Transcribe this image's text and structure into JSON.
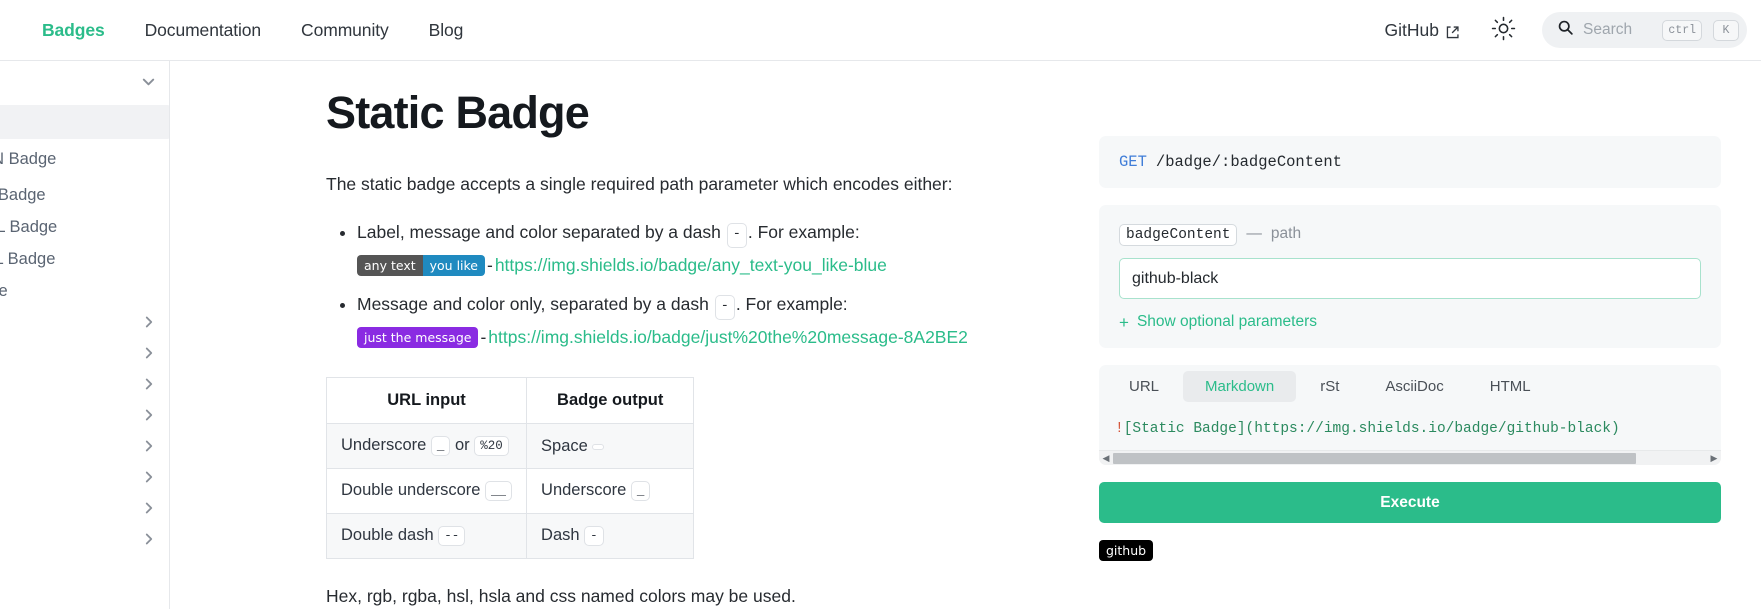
{
  "navbar": {
    "links": [
      {
        "label": "Badges",
        "active": true
      },
      {
        "label": "Documentation",
        "active": false
      },
      {
        "label": "Community",
        "active": false
      },
      {
        "label": "Blog",
        "active": false
      }
    ],
    "github_label": "GitHub",
    "github_icon": "external-link-icon",
    "theme_icon": "sun-icon",
    "search": {
      "icon": "search-icon",
      "placeholder": "Search",
      "kbd_1": "ctrl",
      "kbd_2": "K"
    }
  },
  "sidebar": {
    "group_header_label": "",
    "group_chevron_icon": "chevron-down-icon",
    "items": [
      {
        "label": "",
        "selected": true,
        "chevron": ""
      },
      {
        "label": "JSON Badge",
        "selected": false,
        "chevron": ""
      },
      {
        "label": "XML Badge",
        "selected": false,
        "chevron": ""
      },
      {
        "label": "TOML Badge",
        "selected": false,
        "chevron": ""
      },
      {
        "label": "YAML Badge",
        "selected": false,
        "chevron": ""
      },
      {
        "label": "Badge",
        "selected": false,
        "chevron": ""
      },
      {
        "label": "",
        "selected": false,
        "chevron": "chevron-right-icon"
      },
      {
        "label": "",
        "selected": false,
        "chevron": "chevron-right-icon"
      },
      {
        "label": "",
        "selected": false,
        "chevron": "chevron-right-icon"
      },
      {
        "label": "",
        "selected": false,
        "chevron": "chevron-right-icon"
      },
      {
        "label": "",
        "selected": false,
        "chevron": "chevron-right-icon"
      },
      {
        "label": "",
        "selected": false,
        "chevron": "chevron-right-icon"
      },
      {
        "label": "",
        "selected": false,
        "chevron": "chevron-right-icon"
      },
      {
        "label": "",
        "selected": false,
        "chevron": "chevron-right-icon"
      }
    ]
  },
  "main": {
    "title": "Static Badge",
    "intro": "The static badge accepts a single required path parameter which encodes either:",
    "bullets": [
      {
        "text_before": "Label, message and color separated by a dash",
        "code": "-",
        "text_after": ". For example:",
        "badge": {
          "style": "two-part",
          "left": "any text",
          "right": "you like",
          "left_color": "#555555",
          "right_color": "#1f8ac0"
        },
        "dash": "-",
        "url": "https://img.shields.io/badge/any_text-you_like-blue"
      },
      {
        "text_before": "Message and color only, separated by a dash",
        "code": "-",
        "text_after": ". For example:",
        "badge": {
          "style": "single",
          "left": "just the message",
          "left_color": "#8A2BE2"
        },
        "dash": "-",
        "url": "https://img.shields.io/badge/just%20the%20message-8A2BE2"
      }
    ],
    "table": {
      "headers": [
        "URL input",
        "Badge output"
      ],
      "rows": [
        {
          "in_text": "Underscore",
          "in_code1": "_",
          "in_mid": "or",
          "in_code2": "%20",
          "out_text": "Space",
          "out_code": " "
        },
        {
          "in_text": "Double underscore",
          "in_code1": "__",
          "in_mid": "",
          "in_code2": "",
          "out_text": "Underscore",
          "out_code": "_"
        },
        {
          "in_text": "Double dash",
          "in_code1": "--",
          "in_mid": "",
          "in_code2": "",
          "out_text": "Dash",
          "out_code": "-"
        }
      ]
    },
    "footnote": "Hex, rgb, rgba, hsl, hsla and css named colors may be used."
  },
  "api": {
    "endpoint": {
      "method": "GET",
      "path": "/badge/:badgeContent"
    },
    "parameter": {
      "name": "badgeContent",
      "kind_dash": "—",
      "kind": "path",
      "value": "github-black",
      "placeholder": ""
    },
    "show_optional": {
      "plus": "+",
      "label": "Show optional parameters"
    },
    "tabs": [
      {
        "label": "URL",
        "active": false
      },
      {
        "label": "Markdown",
        "active": true
      },
      {
        "label": "rSt",
        "active": false
      },
      {
        "label": "AsciiDoc",
        "active": false
      },
      {
        "label": "HTML",
        "active": false
      }
    ],
    "snippet": {
      "bang": "!",
      "rest": "[Static Badge](https://img.shields.io/badge/github-black)"
    },
    "scrollbar": {
      "left_arrow": "◀",
      "right_arrow": "▶"
    },
    "execute_label": "Execute",
    "result_badge": {
      "label": "github",
      "color": "#000000"
    }
  },
  "colors": {
    "accent": "#2bbc8a",
    "method_blue": "#3f7dd8",
    "panel_bg": "#f6f8f9",
    "text": "#272b30"
  }
}
